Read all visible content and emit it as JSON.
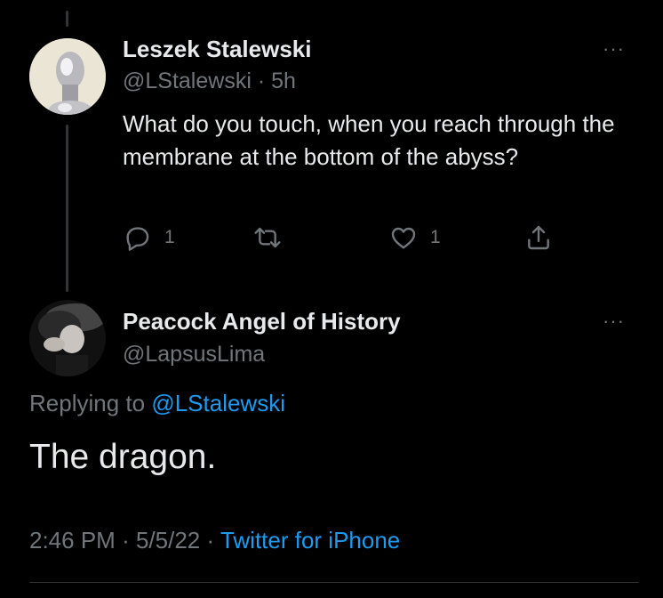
{
  "tweet": {
    "author_name": "Leszek Stalewski",
    "author_handle": "@LStalewski",
    "separator": "·",
    "time": "5h",
    "text": "What do you touch, when you reach through the membrane at the bottom of the abyss?",
    "more": "···",
    "actions": {
      "reply_count": "1",
      "like_count": "1"
    }
  },
  "reply": {
    "author_name": "Peacock Angel of History",
    "author_handle": "@LapsusLima",
    "more": "···",
    "replying_prefix": "Replying to",
    "replying_to": "@LStalewski",
    "text": "The dragon.",
    "time": "2:46 PM",
    "date": "5/5/22",
    "separator": "·",
    "source": "Twitter for iPhone"
  },
  "colors": {
    "background": "#000000",
    "text": "#e7e9ea",
    "secondary": "#71767b",
    "accent": "#1d9bf0"
  },
  "icons": {
    "reply": "speech-bubble-icon",
    "retweet": "retweet-arrows-icon",
    "like": "heart-icon",
    "share": "upload-icon",
    "more": "ellipsis-icon"
  }
}
